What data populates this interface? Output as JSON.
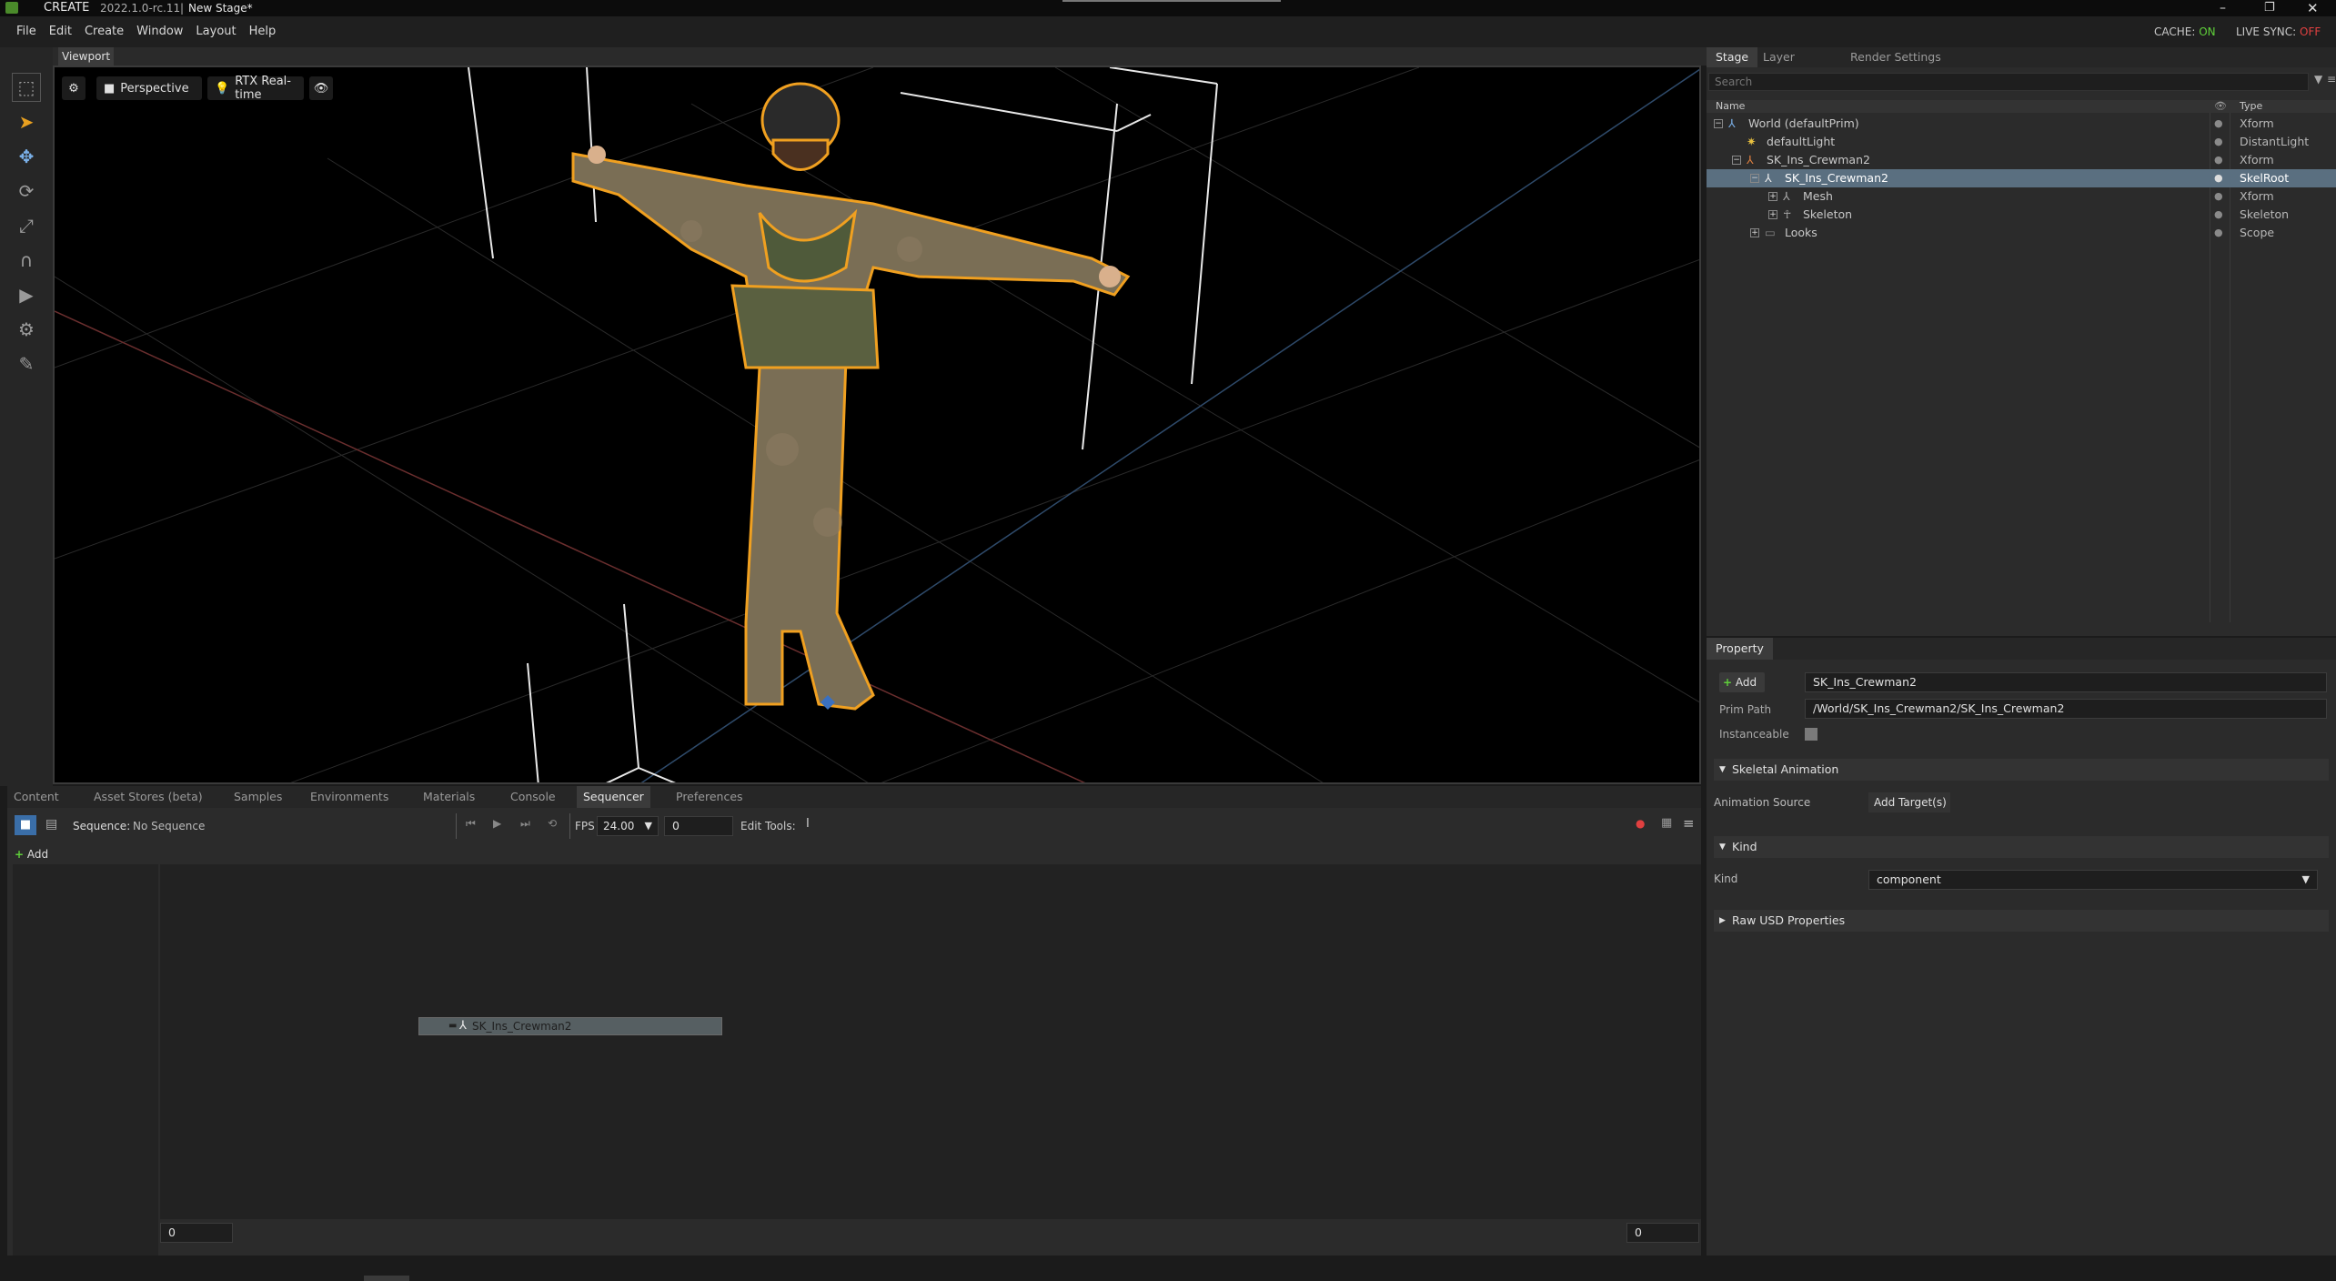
{
  "title": {
    "app": "CREATE",
    "version": "2022.1.0-rc.11",
    "separator": "|",
    "stage": "New Stage*"
  },
  "menu": [
    "File",
    "Edit",
    "Create",
    "Window",
    "Layout",
    "Help"
  ],
  "status": {
    "cache_label": "CACHE:",
    "cache_value": "ON",
    "live_label": "LIVE SYNC:",
    "live_value": "OFF"
  },
  "viewport": {
    "tab": "Viewport",
    "camera": "Perspective",
    "renderer": "RTX Real-time"
  },
  "stage_panel": {
    "tabs": [
      "Stage",
      "Layer",
      "Render Settings"
    ],
    "search_placeholder": "Search",
    "col_name": "Name",
    "col_type": "Type",
    "rows": [
      {
        "name": "World (defaultPrim)",
        "type": "Xform"
      },
      {
        "name": "defaultLight",
        "type": "DistantLight"
      },
      {
        "name": "SK_Ins_Crewman2",
        "type": "Xform"
      },
      {
        "name": "SK_Ins_Crewman2",
        "type": "SkelRoot"
      },
      {
        "name": "Mesh",
        "type": "Xform"
      },
      {
        "name": "Skeleton",
        "type": "Skeleton"
      },
      {
        "name": "Looks",
        "type": "Scope"
      }
    ]
  },
  "property": {
    "tab": "Property",
    "add_label": "Add",
    "name_value": "SK_Ins_Crewman2",
    "prim_path_label": "Prim Path",
    "prim_path_value": "/World/SK_Ins_Crewman2/SK_Ins_Crewman2",
    "instanceable_label": "Instanceable",
    "section_skel": "Skeletal Animation",
    "anim_source_label": "Animation Source",
    "add_targets": "Add Target(s)",
    "section_kind": "Kind",
    "kind_label": "Kind",
    "kind_value": "component",
    "section_raw": "Raw USD Properties"
  },
  "bottom": {
    "tabs": [
      "Content",
      "Asset Stores (beta)",
      "Samples",
      "Environments",
      "Materials",
      "Console",
      "Sequencer",
      "Preferences"
    ],
    "sequence_label": "Sequence:",
    "sequence_value": "No Sequence",
    "fps_label": "FPS",
    "fps_value": "24.00",
    "frame_value": "0",
    "edit_tools": "Edit Tools:",
    "add_label": "Add",
    "track_label": "SK_Ins_Crewman2",
    "start_value": "0",
    "end_value": "0"
  }
}
